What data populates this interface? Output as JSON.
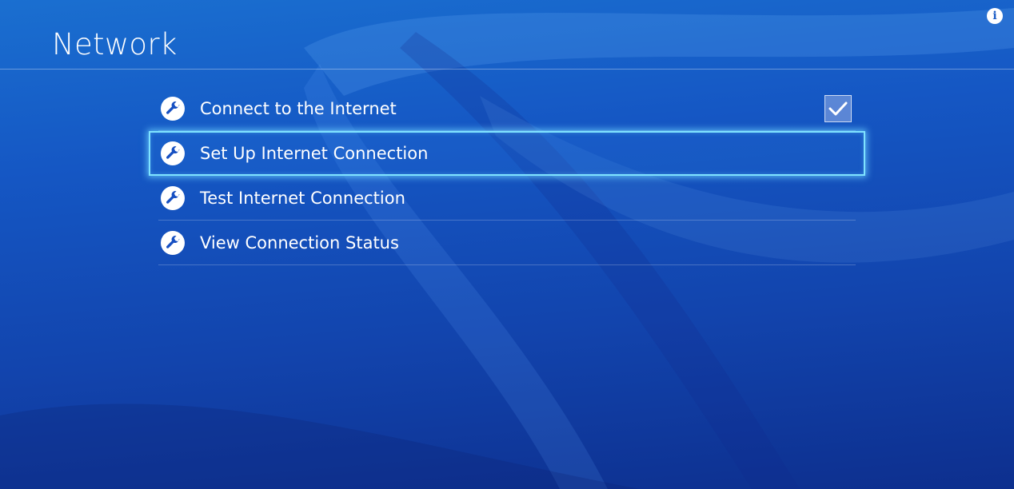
{
  "header": {
    "title": "Network",
    "info_icon": "info-icon",
    "info_glyph": "i"
  },
  "menu": {
    "items": [
      {
        "label": "Connect to the Internet",
        "icon": "wrench-icon",
        "checkbox": true,
        "checked": true,
        "selected": false
      },
      {
        "label": "Set Up Internet Connection",
        "icon": "wrench-icon",
        "checkbox": false,
        "selected": true
      },
      {
        "label": "Test Internet Connection",
        "icon": "wrench-icon",
        "checkbox": false,
        "selected": false
      },
      {
        "label": "View Connection Status",
        "icon": "wrench-icon",
        "checkbox": false,
        "selected": false
      }
    ]
  },
  "colors": {
    "background": "#1557c4",
    "highlight": "#7fe3ff",
    "text": "#ffffff"
  }
}
